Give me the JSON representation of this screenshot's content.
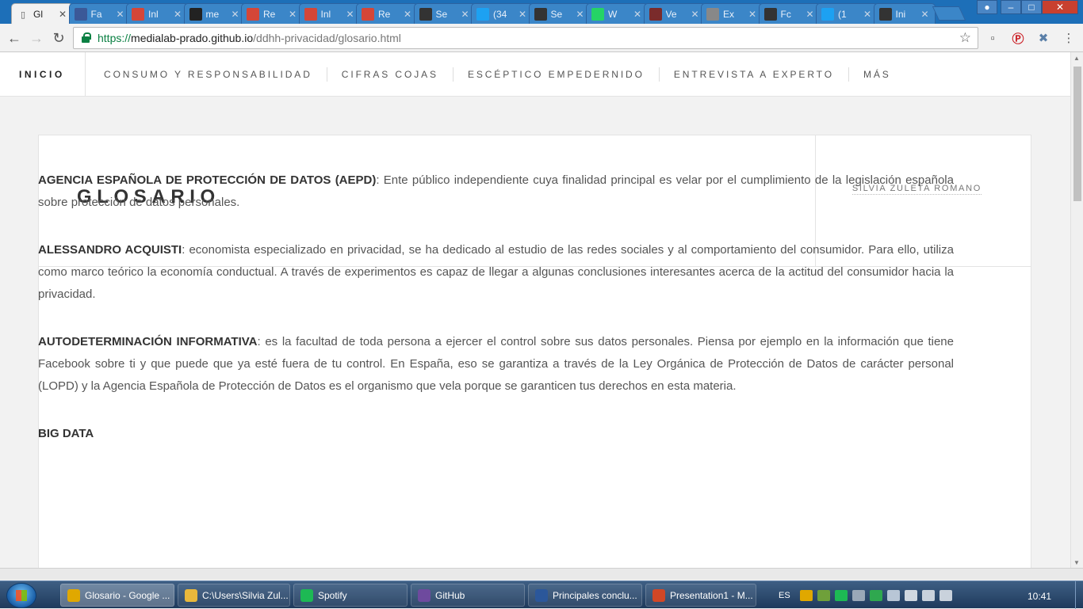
{
  "browser": {
    "tabs": [
      {
        "title": "Gl",
        "icon": "document-icon",
        "color": "#f2f2f2",
        "active": true
      },
      {
        "title": "Fa",
        "icon": "facebook-icon",
        "color": "#3b5998"
      },
      {
        "title": "Inl",
        "icon": "gmail-icon",
        "color": "#d44638"
      },
      {
        "title": "me",
        "icon": "github-icon",
        "color": "#222222"
      },
      {
        "title": "Re",
        "icon": "gmail-icon",
        "color": "#d44638"
      },
      {
        "title": "Inl",
        "icon": "gmail-icon",
        "color": "#d44638"
      },
      {
        "title": "Re",
        "icon": "gmail-icon",
        "color": "#d44638"
      },
      {
        "title": "Se",
        "icon": "mp-icon",
        "color": "#333333"
      },
      {
        "title": "(34",
        "icon": "twitter-icon",
        "color": "#1da1f2"
      },
      {
        "title": "Se",
        "icon": "mp-icon",
        "color": "#333333"
      },
      {
        "title": "W",
        "icon": "whatsapp-icon",
        "color": "#25d366"
      },
      {
        "title": "Ve",
        "icon": "monitor-icon",
        "color": "#7a2b2b"
      },
      {
        "title": "Ex",
        "icon": "document-icon",
        "color": "#888888"
      },
      {
        "title": "Fc",
        "icon": "openai-icon",
        "color": "#333333"
      },
      {
        "title": "(1",
        "icon": "twitter-icon",
        "color": "#1da1f2"
      },
      {
        "title": "Ini",
        "icon": "elpais-icon",
        "color": "#333333"
      }
    ],
    "url": {
      "scheme": "https://",
      "host": "medialab-prado.github.io",
      "path": "/ddhh-privacidad/glosario.html"
    }
  },
  "site_nav": {
    "home": "INICIO",
    "items": [
      "CONSUMO Y RESPONSABILIDAD",
      "CIFRAS COJAS",
      "ESCÉPTICO EMPEDERNIDO",
      "ENTREVISTA A EXPERTO",
      "MÁS"
    ]
  },
  "page": {
    "title": "GLOSARIO",
    "author": "SILVIA ZULETA ROMANO",
    "entries": [
      {
        "term": "AGENCIA ESPAÑOLA DE PROTECCIÓN DE DATOS (AEPD)",
        "text": ": Ente público independiente cuya finalidad principal es velar por el cumplimiento de la legislación española sobre protección de datos personales."
      },
      {
        "term": "ALESSANDRO ACQUISTI",
        "text": ": economista especializado en privacidad, se ha dedicado al estudio de las redes sociales y al comportamiento del consumidor. Para ello, utiliza como marco teórico la economía conductual. A través de experimentos es capaz de llegar a algunas conclusiones interesantes acerca de la actitud del consumidor hacia la privacidad."
      },
      {
        "term": "AUTODETERMINACIÓN INFORMATIVA",
        "text": ": es la facultad de toda persona a ejercer el control sobre sus datos personales. Piensa por ejemplo en la información que tiene Facebook sobre ti y que puede que ya esté fuera de tu control. En España, eso se garantiza a través de la Ley Orgánica de Protección de Datos de carácter personal (LOPD) y la Agencia Española de Protección de Datos es el organismo que vela porque se garanticen tus derechos en esta materia."
      },
      {
        "term": "BIG DATA",
        "text": ""
      }
    ]
  },
  "taskbar": {
    "tasks": [
      {
        "label": "Glosario - Google ...",
        "icon": "chrome-icon",
        "color": "#e0a800",
        "active": true
      },
      {
        "label": "C:\\Users\\Silvia Zul...",
        "icon": "folder-icon",
        "color": "#e9b83c"
      },
      {
        "label": "Spotify",
        "icon": "spotify-icon",
        "color": "#1db954"
      },
      {
        "label": "GitHub",
        "icon": "github-icon",
        "color": "#6e4a9e"
      },
      {
        "label": "Principales conclu...",
        "icon": "word-icon",
        "color": "#2b579a"
      },
      {
        "label": "Presentation1 - M...",
        "icon": "powerpoint-icon",
        "color": "#d24726"
      }
    ],
    "lang": "ES",
    "clock": "10:41"
  }
}
